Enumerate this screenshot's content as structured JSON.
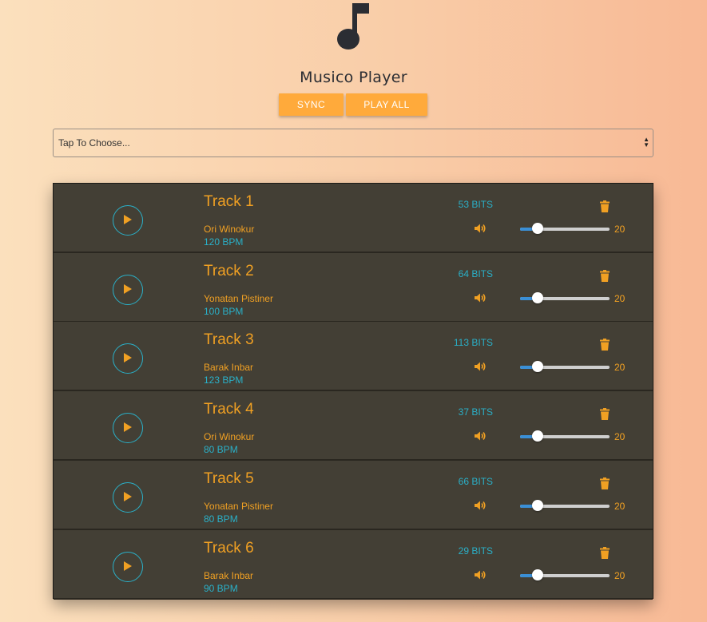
{
  "app": {
    "title": "Musico Player",
    "logo_icon": "music-note-icon"
  },
  "toolbar": {
    "sync_label": "SYNC",
    "play_all_label": "PLAY ALL"
  },
  "chooser": {
    "value": "Tap To Choose..."
  },
  "colors": {
    "accent_orange": "#f0a023",
    "button_orange": "#ffaa3b",
    "accent_cyan": "#2ab0c8",
    "row_bg": "#433f35",
    "slider_fill": "#3a8fd6"
  },
  "tracks": [
    {
      "name": "Track 1",
      "artist": "Ori Winokur",
      "bpm": "120 BPM",
      "bits": "53 BITS",
      "volume": "20",
      "volume_fraction": 0.2
    },
    {
      "name": "Track 2",
      "artist": "Yonatan Pistiner",
      "bpm": "100 BPM",
      "bits": "64 BITS",
      "volume": "20",
      "volume_fraction": 0.2
    },
    {
      "name": "Track 3",
      "artist": "Barak Inbar",
      "bpm": "123 BPM",
      "bits": "113 BITS",
      "volume": "20",
      "volume_fraction": 0.2
    },
    {
      "name": "Track 4",
      "artist": "Ori Winokur",
      "bpm": "80 BPM",
      "bits": "37 BITS",
      "volume": "20",
      "volume_fraction": 0.2
    },
    {
      "name": "Track 5",
      "artist": "Yonatan Pistiner",
      "bpm": "80 BPM",
      "bits": "66 BITS",
      "volume": "20",
      "volume_fraction": 0.2
    },
    {
      "name": "Track 6",
      "artist": "Barak Inbar",
      "bpm": "90 BPM",
      "bits": "29 BITS",
      "volume": "20",
      "volume_fraction": 0.2
    }
  ],
  "icons": {
    "play": "play-icon",
    "volume": "volume-icon",
    "delete": "trash-icon"
  }
}
